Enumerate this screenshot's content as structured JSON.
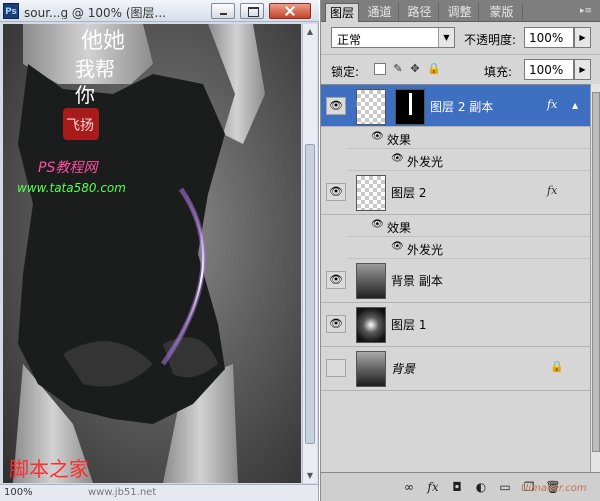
{
  "document": {
    "app_icon": "Ps",
    "title": "sour...g @ 100% (图层...",
    "zoom": "100%",
    "site_url": "www.jb51.net",
    "controls": [
      "minimize-icon",
      "maximize-icon",
      "close-icon"
    ]
  },
  "artwork": {
    "calligraphy": [
      "他",
      "她",
      "我",
      "帮",
      "你"
    ],
    "seal": "飞扬",
    "site_label": "PS教程网",
    "site_url": "www.tata580.com",
    "brand": "脚本之家"
  },
  "panel": {
    "tabs": [
      "图层",
      "通道",
      "路径",
      "调整",
      "蒙版"
    ],
    "active_tab": 0,
    "blend_mode": "正常",
    "opacity_label": "不透明度:",
    "opacity_value": "100%",
    "lock_label": "锁定:",
    "fill_label": "填充:",
    "fill_value": "100%",
    "lock_icons": [
      "lock-transparent-pixels-icon",
      "lock-image-pixels-icon",
      "lock-position-icon",
      "lock-all-icon"
    ],
    "footer_icons": [
      "link-layers-icon",
      "layer-style-icon",
      "add-mask-icon",
      "adjustment-layer-icon",
      "new-group-icon",
      "new-layer-icon",
      "delete-layer-icon"
    ],
    "fx_symbol": "fx",
    "layers": [
      {
        "name": "图层 2 副本",
        "selected": true,
        "visible": true,
        "has_mask": true,
        "fx": true,
        "effects_label": "效果",
        "effect": "外发光"
      },
      {
        "name": "图层 2",
        "selected": false,
        "visible": true,
        "has_mask": false,
        "fx": true,
        "effects_label": "效果",
        "effect": "外发光"
      },
      {
        "name": "背景 副本",
        "selected": false,
        "visible": true
      },
      {
        "name": "图层 1",
        "selected": false,
        "visible": true
      },
      {
        "name": "背景",
        "selected": false,
        "visible": false,
        "locked": true
      }
    ],
    "footer_watermark": "Uimaker.com"
  }
}
